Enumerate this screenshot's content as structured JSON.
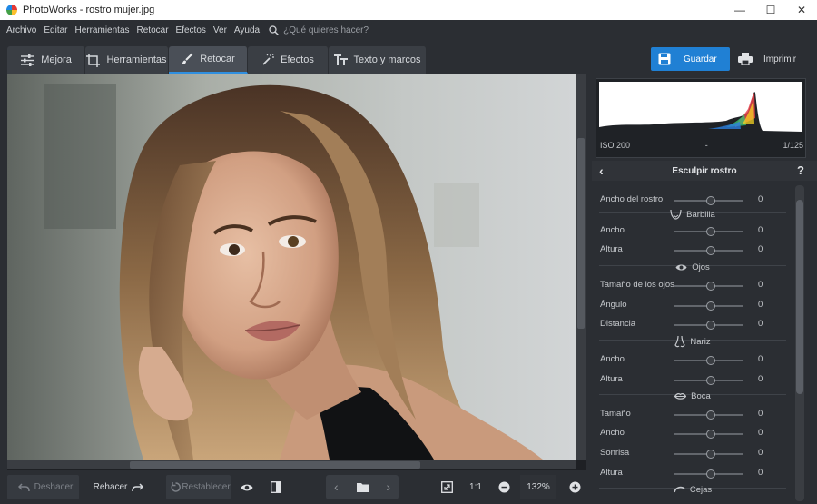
{
  "window": {
    "title": "PhotoWorks - rostro mujer.jpg",
    "minimize_glyph": "—",
    "maximize_glyph": "☐",
    "close_glyph": "✕"
  },
  "menu": {
    "items": [
      "Archivo",
      "Editar",
      "Herramientas",
      "Retocar",
      "Efectos",
      "Ver",
      "Ayuda"
    ],
    "search_placeholder": "¿Qué quieres hacer?"
  },
  "tabs": [
    {
      "label": "Mejora",
      "icon": "sliders-icon",
      "active": false
    },
    {
      "label": "Herramientas",
      "icon": "crop-icon",
      "active": false
    },
    {
      "label": "Retocar",
      "icon": "brush-icon",
      "active": true
    },
    {
      "label": "Efectos",
      "icon": "magic-wand-icon",
      "active": false
    },
    {
      "label": "Texto y marcos",
      "icon": "text-icon",
      "active": false
    }
  ],
  "actions": {
    "save_label": "Guardar",
    "print_label": "Imprimir"
  },
  "histogram": {
    "iso": "ISO 200",
    "middle": "-",
    "shutter": "1/125"
  },
  "panel": {
    "title": "Esculpir rostro",
    "back_glyph": "‹",
    "help_glyph": "?"
  },
  "sculpt": [
    {
      "kind": "slider",
      "label": "Ancho del rostro",
      "value": "0"
    },
    {
      "kind": "section",
      "label": "Barbilla",
      "icon": "chin-icon"
    },
    {
      "kind": "slider",
      "label": "Ancho",
      "value": "0"
    },
    {
      "kind": "slider",
      "label": "Altura",
      "value": "0"
    },
    {
      "kind": "section",
      "label": "Ojos",
      "icon": "eye-icon"
    },
    {
      "kind": "slider",
      "label": "Tamaño de los ojos",
      "value": "0"
    },
    {
      "kind": "slider",
      "label": "Ángulo",
      "value": "0"
    },
    {
      "kind": "slider",
      "label": "Distancia",
      "value": "0"
    },
    {
      "kind": "section",
      "label": "Nariz",
      "icon": "nose-icon"
    },
    {
      "kind": "slider",
      "label": "Ancho",
      "value": "0"
    },
    {
      "kind": "slider",
      "label": "Altura",
      "value": "0"
    },
    {
      "kind": "section",
      "label": "Boca",
      "icon": "lips-icon"
    },
    {
      "kind": "slider",
      "label": "Tamaño",
      "value": "0"
    },
    {
      "kind": "slider",
      "label": "Ancho",
      "value": "0"
    },
    {
      "kind": "slider",
      "label": "Sonrisa",
      "value": "0"
    },
    {
      "kind": "slider",
      "label": "Altura",
      "value": "0"
    },
    {
      "kind": "section",
      "label": "Cejas",
      "icon": "brow-icon"
    }
  ],
  "bottom": {
    "undo_label": "Deshacer",
    "redo_label": "Rehacer",
    "reset_label": "Restablecer",
    "one_to_one": "1:1",
    "zoom": "132%"
  },
  "colors": {
    "accent": "#2080d4",
    "panel_bg": "#2b2e33"
  }
}
